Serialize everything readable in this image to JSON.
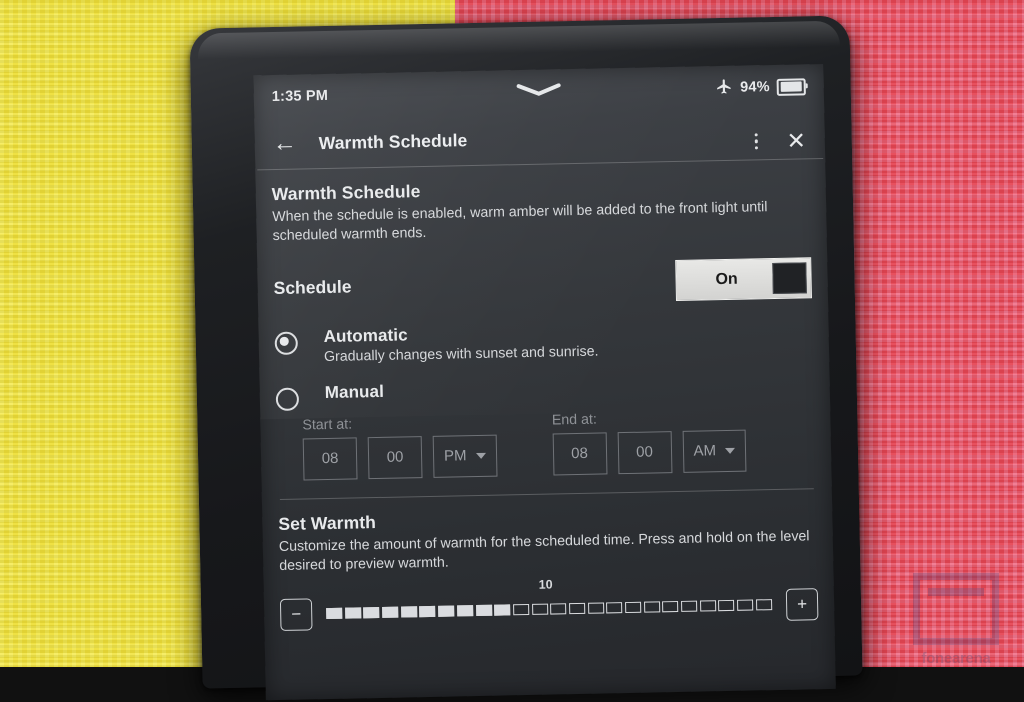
{
  "background": {
    "left_color": "#f2e64a",
    "right_color": "#ec5d70",
    "top_accent_color": "#d8244f"
  },
  "device": {
    "bezel_color": "#1e2023",
    "screen_bg_color": "#34373b"
  },
  "status_bar": {
    "time": "1:35 PM",
    "airplane_icon": "airplane-mode-icon",
    "battery_percent": "94%",
    "battery_icon": "battery-icon",
    "drag_handle_icon": "chevron-down-handle-icon"
  },
  "app_bar": {
    "back_icon": "←",
    "title": "Warmth Schedule",
    "overflow_icon": "overflow-menu-icon",
    "close_icon": "✕"
  },
  "main": {
    "heading": "Warmth Schedule",
    "description": "When the schedule is enabled, warm amber will be added to the front light until scheduled warmth ends.",
    "schedule": {
      "label": "Schedule",
      "toggle_state": "On",
      "toggle_on": true
    },
    "options": [
      {
        "id": "automatic",
        "title": "Automatic",
        "subtitle": "Gradually changes with sunset and sunrise.",
        "selected": true
      },
      {
        "id": "manual",
        "title": "Manual",
        "subtitle": "",
        "selected": false
      }
    ],
    "time_pickers": {
      "start": {
        "label": "Start at:",
        "hour": "08",
        "minute": "00",
        "meridiem": "PM"
      },
      "end": {
        "label": "End at:",
        "hour": "08",
        "minute": "00",
        "meridiem": "AM"
      },
      "enabled": false
    },
    "set_warmth": {
      "heading": "Set Warmth",
      "description": "Customize the amount of warmth for the scheduled time. Press and hold on the level desired to preview warmth.",
      "value_label": "10",
      "value": 10,
      "max": 24,
      "decrease_label": "−",
      "increase_label": "+"
    }
  },
  "watermark": {
    "text": "fonearena"
  }
}
